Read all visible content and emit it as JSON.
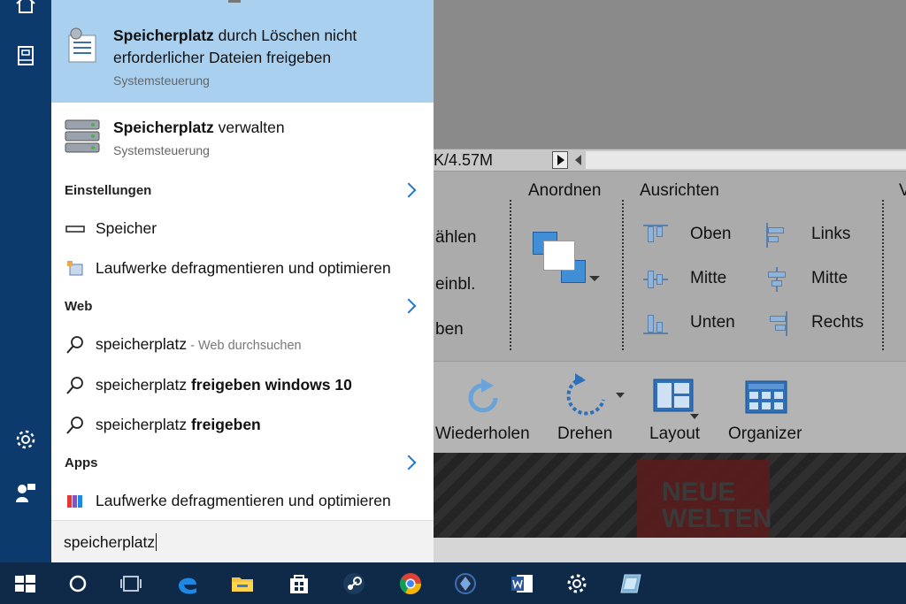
{
  "background_app": {
    "file_size_text": "K/4.57M",
    "ribbon": {
      "partial_left": [
        "ählen",
        "einbl.",
        "ben"
      ],
      "arrange_group_label": "Anordnen",
      "align_group_label": "Ausrichten",
      "partial_right_group": "V",
      "align_items": [
        "Oben",
        "Mitte",
        "Unten",
        "Links",
        "Mitte",
        "Rechts"
      ]
    },
    "toolbar": {
      "redo_label": "Wiederholen",
      "rotate_label": "Drehen",
      "layout_label": "Layout",
      "organizer_label": "Organizer"
    },
    "photo_text": [
      "NEUE",
      "WELTEN"
    ]
  },
  "start_rail": {
    "icons": [
      "home-icon",
      "notebook-icon",
      "settings-gear-icon",
      "feedback-icon"
    ]
  },
  "search_panel": {
    "best_match": {
      "title_bold": "Speicherplatz",
      "title_rest_line1": " durch Löschen nicht",
      "title_line2": "erforderlicher Dateien freigeben",
      "subtitle": "Systemsteuerung"
    },
    "second_match": {
      "title_bold": "Speicherplatz",
      "title_rest": " verwalten",
      "subtitle": "Systemsteuerung"
    },
    "settings_header": "Einstellungen",
    "settings_items": [
      "Speicher",
      "Laufwerke defragmentieren und optimieren"
    ],
    "web_header": "Web",
    "web_items": [
      {
        "normal": "speicherplatz",
        "muted": " - Web durchsuchen",
        "bold": ""
      },
      {
        "normal": "speicherplatz ",
        "muted": "",
        "bold": "freigeben windows 10"
      },
      {
        "normal": "speicherplatz ",
        "muted": "",
        "bold": "freigeben"
      }
    ],
    "apps_header": "Apps",
    "apps_items": [
      "Laufwerke defragmentieren und optimieren"
    ],
    "query": "speicherplatz"
  },
  "taskbar": {
    "icons": [
      "windows-start-icon",
      "cortana-search-icon",
      "task-view-icon",
      "edge-icon",
      "file-explorer-icon",
      "store-icon",
      "steam-icon",
      "chrome-icon",
      "app-icon",
      "word-icon",
      "settings-icon",
      "app2-icon"
    ]
  },
  "colors": {
    "highlight": "#a9d0ef",
    "accent": "#1f78d1",
    "rail": "#0d3a6c",
    "taskbar": "#0e2a48"
  }
}
